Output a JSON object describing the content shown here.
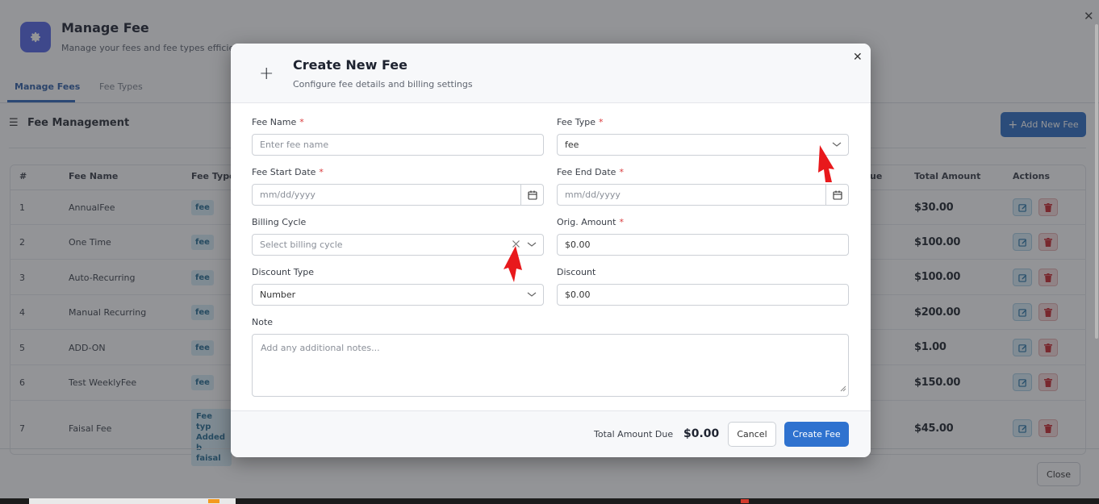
{
  "app": {
    "title": "Manage Fee",
    "subtitle": "Manage your fees and fee types efficiently"
  },
  "tabs": [
    {
      "label": "Manage Fees",
      "active": true
    },
    {
      "label": "Fee Types",
      "active": false
    }
  ],
  "section": {
    "title": "Fee Management",
    "add_button": "Add New Fee"
  },
  "table": {
    "headers": [
      "#",
      "Fee Name",
      "Fee Type",
      "ue",
      "Total Amount",
      "Actions"
    ],
    "rows": [
      {
        "num": "1",
        "name": "AnnualFee",
        "type": "fee",
        "total": "$30.00"
      },
      {
        "num": "2",
        "name": "One Time",
        "type": "fee",
        "total": "$100.00"
      },
      {
        "num": "3",
        "name": "Auto-Recurring",
        "type": "fee",
        "total": "$100.00"
      },
      {
        "num": "4",
        "name": "Manual Recurring",
        "type": "fee",
        "total": "$200.00"
      },
      {
        "num": "5",
        "name": "ADD-ON",
        "type": "fee",
        "total": "$1.00"
      },
      {
        "num": "6",
        "name": "Test WeeklyFee",
        "type": "fee",
        "total": "$150.00"
      },
      {
        "num": "7",
        "name": "Faisal Fee",
        "type_lines": [
          "Fee typ",
          "Added b",
          "faisal"
        ],
        "total": "$45.00"
      }
    ]
  },
  "page_close_button": "Close",
  "modal": {
    "title": "Create New Fee",
    "subtitle": "Configure fee details and billing settings",
    "fields": {
      "fee_name": {
        "label": "Fee Name",
        "placeholder": "Enter fee name",
        "required": "*"
      },
      "fee_type": {
        "label": "Fee Type",
        "value": "fee",
        "required": "*"
      },
      "start_date": {
        "label": "Fee Start Date",
        "placeholder": "mm/dd/yyyy",
        "required": "*"
      },
      "end_date": {
        "label": "Fee End Date",
        "placeholder": "mm/dd/yyyy",
        "required": "*"
      },
      "billing_cycle": {
        "label": "Billing Cycle",
        "placeholder": "Select billing cycle"
      },
      "orig_amount": {
        "label": "Orig. Amount",
        "value": "$0.00",
        "required": "*"
      },
      "discount_type": {
        "label": "Discount Type",
        "value": "Number"
      },
      "discount": {
        "label": "Discount",
        "value": "$0.00"
      },
      "note": {
        "label": "Note",
        "placeholder": "Add any additional notes..."
      }
    },
    "footer": {
      "total_label": "Total Amount Due",
      "total_value": "$0.00",
      "cancel": "Cancel",
      "create": "Create Fee"
    }
  },
  "colors": {
    "primary": "#2f72cf",
    "required": "#d9383a",
    "annotation_arrow": "#e8191c",
    "badge_bg": "#d6ecf6"
  }
}
